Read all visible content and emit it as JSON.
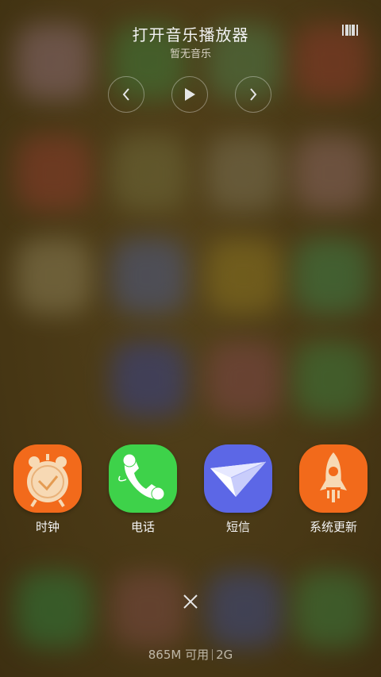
{
  "music": {
    "title": "打开音乐播放器",
    "subtitle": "暂无音乐"
  },
  "icons": {
    "prev": "chevron-left-icon",
    "play": "play-icon",
    "next": "chevron-right-icon",
    "layout": "layout-grid-icon",
    "close": "close-icon"
  },
  "apps": [
    {
      "label": "时钟",
      "icon": "alarm-clock-icon",
      "color": "#f26a1b"
    },
    {
      "label": "电话",
      "icon": "phone-icon",
      "color": "#3ed24a"
    },
    {
      "label": "短信",
      "icon": "paper-plane-icon",
      "color": "#5c67e6"
    },
    {
      "label": "系统更新",
      "icon": "rocket-icon",
      "color": "#f26a1b"
    }
  ],
  "memory": {
    "available": "865M 可用",
    "total": "2G"
  }
}
